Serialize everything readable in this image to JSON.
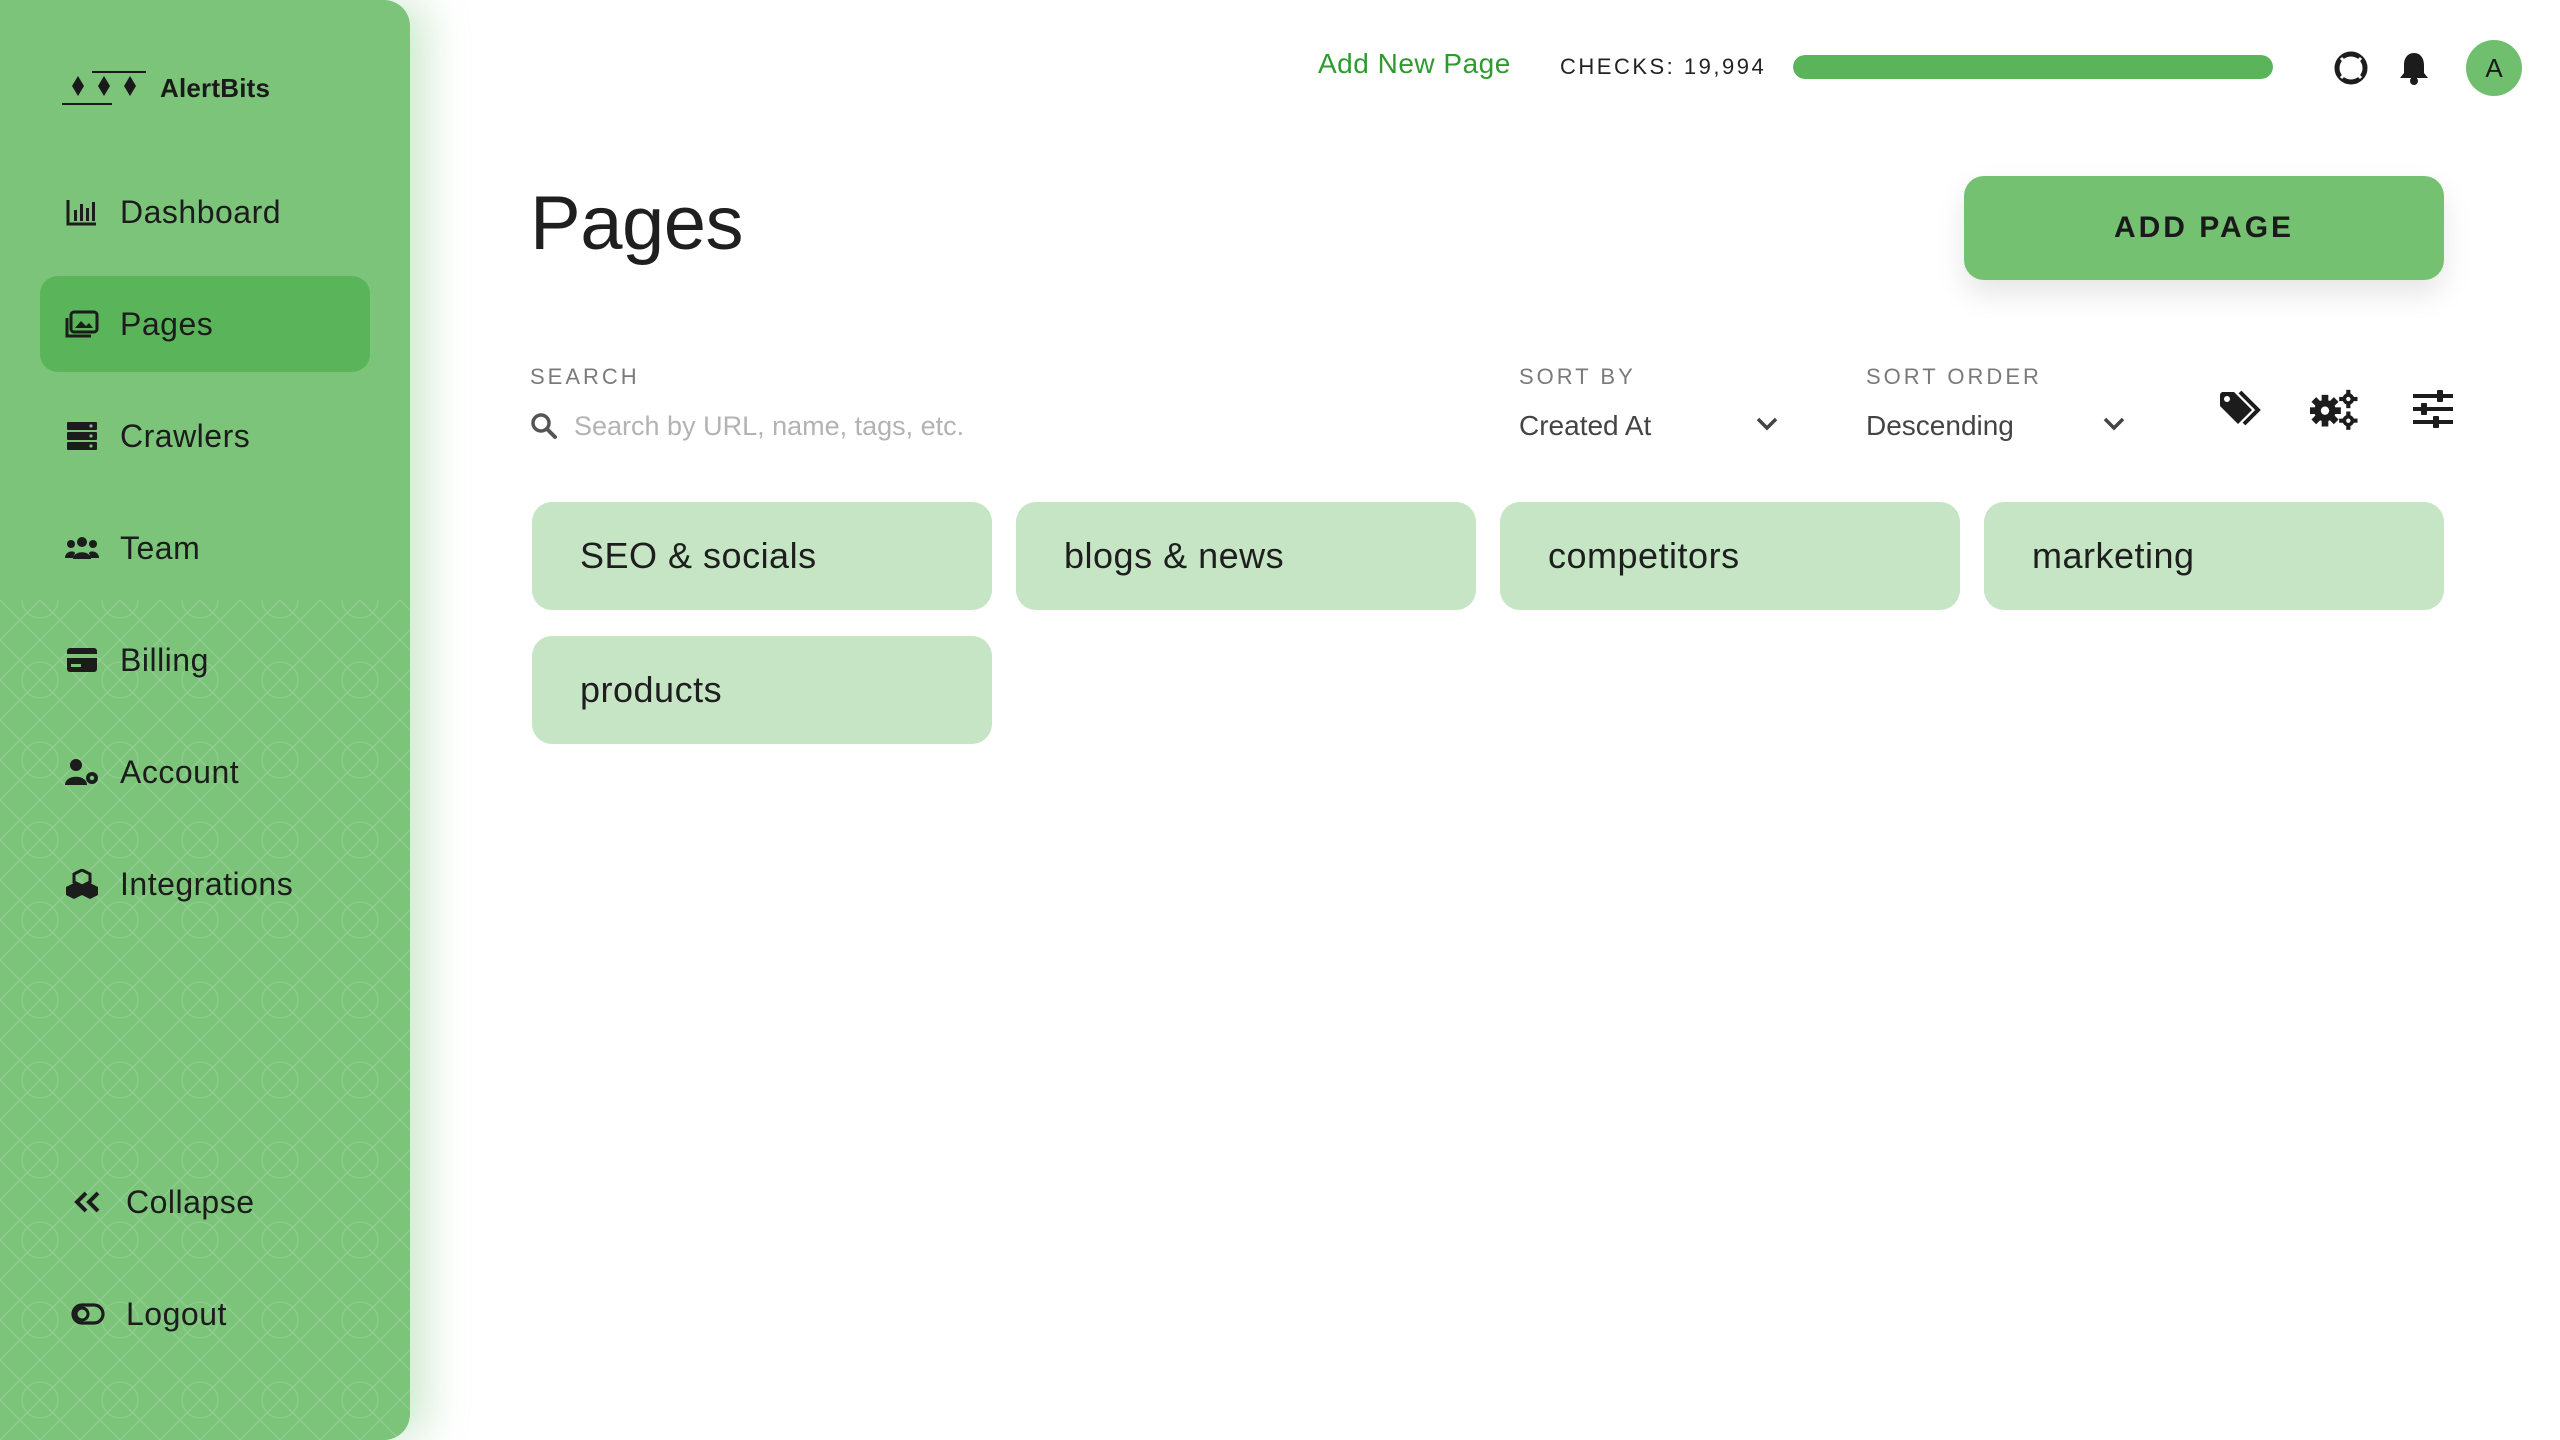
{
  "brand": {
    "name": "AlertBits"
  },
  "sidebar": {
    "items": [
      {
        "label": "Dashboard",
        "icon": "chart-bar-icon",
        "active": false
      },
      {
        "label": "Pages",
        "icon": "images-icon",
        "active": true
      },
      {
        "label": "Crawlers",
        "icon": "server-icon",
        "active": false
      },
      {
        "label": "Team",
        "icon": "users-icon",
        "active": false
      },
      {
        "label": "Billing",
        "icon": "credit-card-icon",
        "active": false
      },
      {
        "label": "Account",
        "icon": "user-gear-icon",
        "active": false
      },
      {
        "label": "Integrations",
        "icon": "cubes-icon",
        "active": false
      }
    ],
    "collapse_label": "Collapse",
    "logout_label": "Logout"
  },
  "topbar": {
    "add_new_page_label": "Add New Page",
    "checks_label": "CHECKS: 19,994",
    "checks_progress": 1.0,
    "avatar_initial": "A"
  },
  "header": {
    "title": "Pages",
    "add_page_label": "ADD PAGE"
  },
  "filters": {
    "search_label": "SEARCH",
    "search_placeholder": "Search by URL, name, tags, etc.",
    "sort_by_label": "SORT BY",
    "sort_by_value": "Created At",
    "sort_order_label": "SORT ORDER",
    "sort_order_value": "Descending"
  },
  "tags": [
    {
      "label": "SEO & socials"
    },
    {
      "label": "blogs & news"
    },
    {
      "label": "competitors"
    },
    {
      "label": "marketing"
    },
    {
      "label": "products"
    }
  ],
  "colors": {
    "sidebar_bg": "#7bc47a",
    "active_item": "#5ab55a",
    "tag_bg": "#c5e5c4",
    "link_green": "#2e9b2e"
  }
}
